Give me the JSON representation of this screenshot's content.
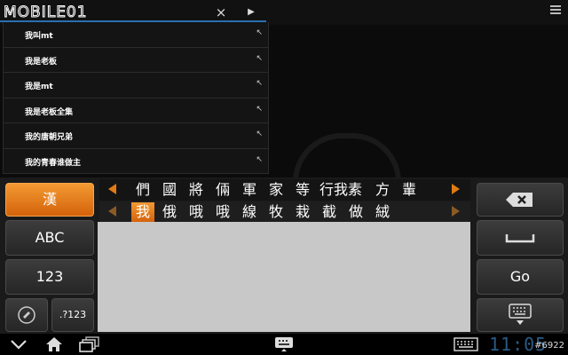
{
  "search": {
    "logo_text": "MOBILE01",
    "clear_glyph": "×",
    "go_glyph": "▶"
  },
  "suggestions": [
    {
      "text": "我叫mt",
      "arrow": "↖"
    },
    {
      "text": "我是老板",
      "arrow": "↖"
    },
    {
      "text": "我是mt",
      "arrow": "↖"
    },
    {
      "text": "我是老板全集",
      "arrow": "↖"
    },
    {
      "text": "我的唐朝兄弟",
      "arrow": "↖"
    },
    {
      "text": "我的青春谁做主",
      "arrow": "↖"
    }
  ],
  "keyboard": {
    "left_keys": [
      "漢",
      "ABC",
      "123",
      ".?123"
    ],
    "right_keys": {
      "go": "Go"
    },
    "candidates_row1": [
      "們",
      "國",
      "將",
      "倆",
      "軍",
      "家",
      "等",
      "行我素",
      "方",
      "輩"
    ],
    "candidates_row2": [
      "我",
      "俄",
      "哦",
      "哦",
      "線",
      "牧",
      "栽",
      "截",
      "做",
      "絨"
    ],
    "selected_candidate_index": 0
  },
  "system": {
    "clock": "11:05",
    "watermark": "#6922"
  },
  "colors": {
    "accent_orange": "#e07a12",
    "selection_underline": "#2a6fb0"
  }
}
